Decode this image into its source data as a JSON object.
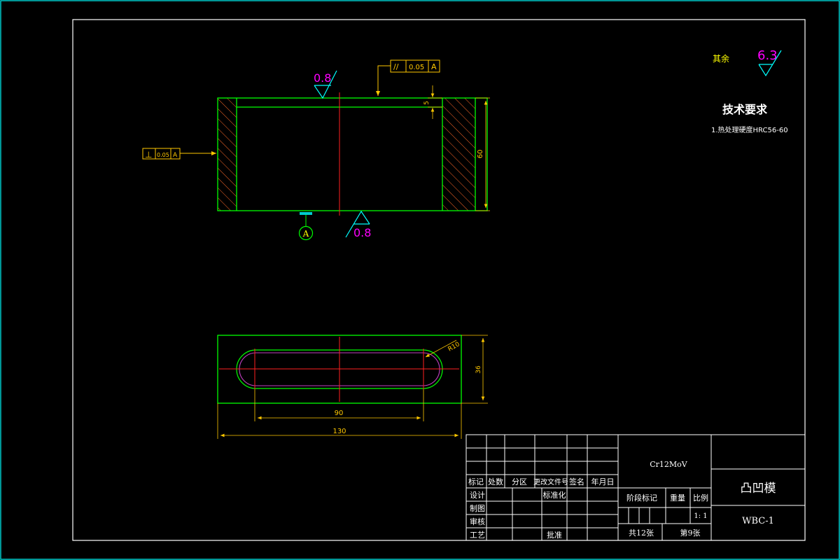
{
  "roughness": {
    "other_label": "其余",
    "other_value": "6.3",
    "top_value": "0.8",
    "bottom_value": "0.8"
  },
  "tech_req": {
    "title": "技术要求",
    "line1": "1.热处理硬度HRC56-60"
  },
  "tolerance": {
    "parallel_symbol": "//",
    "parallel_value": "0.05",
    "parallel_datum": "A",
    "perp_symbol": "⊥",
    "perp_value": "0.05",
    "perp_datum": "A",
    "datum_letter": "A"
  },
  "dimensions": {
    "wall_thickness": "5",
    "height": "60",
    "radius": "R10",
    "width": "36",
    "slot_length": "90",
    "total_length": "130"
  },
  "title_block": {
    "hdr_mark": "标记",
    "hdr_count": "处数",
    "hdr_zone": "分区",
    "hdr_doc": "更改文件号",
    "hdr_sign": "签名",
    "hdr_date": "年月日",
    "design": "设计",
    "standardize": "标准化",
    "drawn": "制图",
    "review": "审核",
    "process": "工艺",
    "approve": "批准",
    "material": "Cr12MoV",
    "stage_mark": "阶段标记",
    "weight": "重量",
    "scale_label": "比例",
    "scale_value": "1: 1",
    "total_sheets": "共12张",
    "sheet_no": "第9张",
    "part_name": "凸凹模",
    "drawing_no": "WBC-1"
  },
  "colors": {
    "background": "#000000",
    "frame": "#ffffff",
    "outer_border": "#00c8c8",
    "outline": "#00ff00",
    "centerline": "#ff2020",
    "dimension": "#ffc800",
    "roughness": "#ff00ff",
    "datum": "#00ffff"
  }
}
